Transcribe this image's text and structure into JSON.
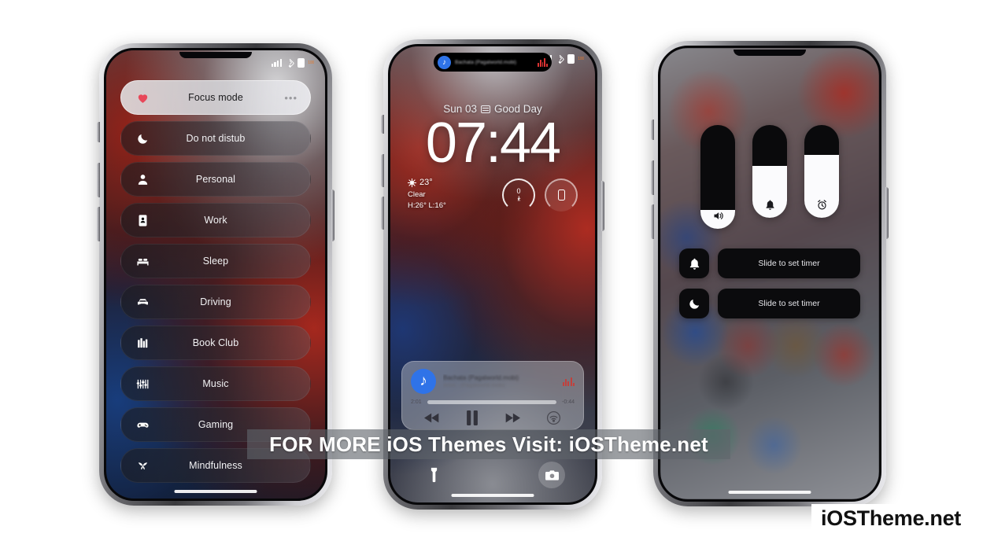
{
  "page": {
    "background_color": "#ffffff",
    "watermark": "FOR MORE iOS Themes Visit: iOSTheme.net",
    "brand": "iOSTheme.net"
  },
  "phone1": {
    "status_bar": {
      "battery_percent": "100"
    },
    "focus_rows": [
      {
        "label": "Focus mode",
        "icon": "heart-icon",
        "active": true,
        "menu": "•••"
      },
      {
        "label": "Do not distub",
        "icon": "moon-icon",
        "active": false
      },
      {
        "label": "Personal",
        "icon": "person-icon",
        "active": false
      },
      {
        "label": "Work",
        "icon": "briefcase-icon",
        "active": false
      },
      {
        "label": "Sleep",
        "icon": "bed-icon",
        "active": false
      },
      {
        "label": "Driving",
        "icon": "car-icon",
        "active": false
      },
      {
        "label": "Book Club",
        "icon": "books-icon",
        "active": false
      },
      {
        "label": "Music",
        "icon": "music-sliders-icon",
        "active": false
      },
      {
        "label": "Gaming",
        "icon": "gamepad-icon",
        "active": false
      },
      {
        "label": "Mindfulness",
        "icon": "mindfulness-icon",
        "active": false
      }
    ],
    "accent_color": "#e8485a"
  },
  "phone2": {
    "dynamic_island": {
      "app_icon": "music-note-icon",
      "app_letter": "♪",
      "title": "Bachata (Pagalworld.mobi)",
      "visualizer_color": "#d33333"
    },
    "lock": {
      "date": "Sun 03",
      "date_icon": "calendar-icon",
      "greeting": "Good Day",
      "time": "07:44"
    },
    "weather": {
      "icon": "sun-icon",
      "temperature": "23°",
      "condition": "Clear",
      "high_low": "H:26° L:16°"
    },
    "widgets": [
      {
        "name": "fitness-ring-widget",
        "value": "0",
        "icon": "walking-person-icon"
      },
      {
        "name": "battery-ring-widget",
        "value": "",
        "icon": "phone-battery-icon"
      }
    ],
    "player": {
      "app_icon": "music-note-icon",
      "app_letter": "♪",
      "track_title": "Bachata (Pagalworld.mobi)",
      "track_artist": "Artist - (Pagalworld.mobi)",
      "elapsed": "2:01",
      "remaining": "-0:44",
      "progress_percent": 72,
      "controls": [
        "rewind-button",
        "pause-button",
        "fast-forward-button",
        "airplay-button"
      ]
    },
    "quick_actions": [
      {
        "name": "flashlight-button",
        "icon": "flashlight-icon"
      },
      {
        "name": "camera-button",
        "icon": "camera-icon"
      }
    ]
  },
  "phone3": {
    "sliders": [
      {
        "name": "volume-slider",
        "icon": "speaker-icon",
        "level_percent": 18
      },
      {
        "name": "ringer-slider",
        "icon": "bell-icon",
        "level_percent": 56
      },
      {
        "name": "alarm-slider",
        "icon": "alarm-clock-icon",
        "level_percent": 68
      }
    ],
    "timer_rows": [
      {
        "name": "ringer-timer-row",
        "icon": "bell-icon",
        "label": "Slide to set timer"
      },
      {
        "name": "sleep-timer-row",
        "icon": "moon-icon",
        "label": "Slide to set timer"
      }
    ]
  }
}
